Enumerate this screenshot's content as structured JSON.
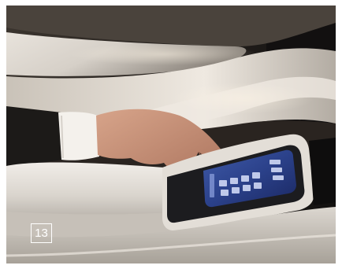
{
  "figure": {
    "badge_number": "13",
    "frame_color": "#ffffff",
    "badge_color": "#ffffff"
  }
}
